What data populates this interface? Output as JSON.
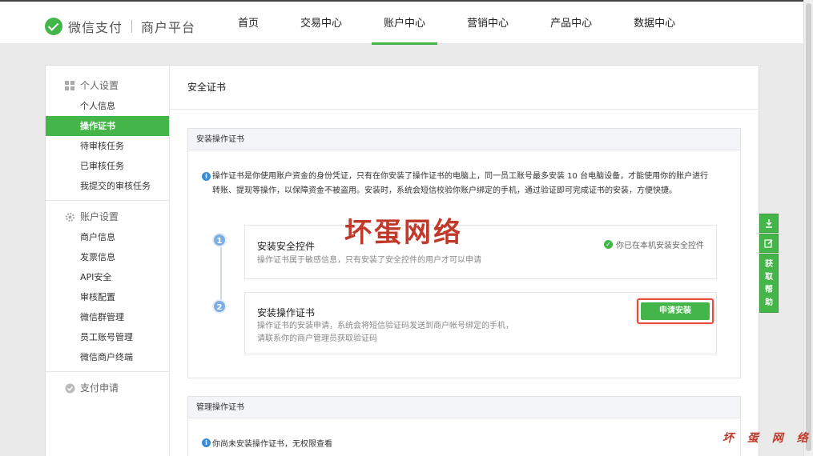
{
  "header": {
    "brand": "微信支付",
    "brand_sub": "商户平台",
    "nav": [
      "首页",
      "交易中心",
      "账户中心",
      "营销中心",
      "产品中心",
      "数据中心"
    ],
    "active_nav": 2
  },
  "sidebar": {
    "groups": [
      {
        "label": "个人设置",
        "icon": "grid-icon",
        "items": [
          "个人信息",
          "操作证书",
          "待审核任务",
          "已审核任务",
          "我提交的审核任务"
        ]
      },
      {
        "label": "账户设置",
        "icon": "gear-icon",
        "items": [
          "商户信息",
          "发票信息",
          "API安全",
          "审核配置",
          "微信群管理",
          "员工账号管理",
          "微信商户终端"
        ]
      },
      {
        "label": "支付申请",
        "icon": "payment-icon",
        "items": []
      }
    ],
    "active_item": "操作证书"
  },
  "content": {
    "title": "安全证书",
    "install_section": {
      "heading": "安装操作证书",
      "info": "操作证书是你使用账户资金的身份凭证，只有在你安装了操作证书的电脑上，同一员工账号最多安装 10 台电脑设备，才能使用你的账户进行转账、提现等操作，以保障资金不被盗用。安装时，系统会短信校验你账户绑定的手机，通过验证即可完成证书的安装，方便快捷。",
      "steps": [
        {
          "num": "1",
          "title": "安装安全控件",
          "desc": "操作证书属于敏感信息，只有安装了安全控件的用户才可以申请",
          "status": "你已在本机安装安全控件"
        },
        {
          "num": "2",
          "title": "安装操作证书",
          "desc1": "操作证书的安装申请，系统会将短信验证码发送到商户帐号绑定的手机，",
          "desc2": "请联系你的商户管理员获取验证码",
          "button": "申请安装"
        }
      ]
    },
    "manage_section": {
      "heading": "管理操作证书",
      "info": "你尚未安装操作证书，无权限查看"
    }
  },
  "watermark": {
    "main": "坏蛋网络",
    "corner": "坏 蛋 网 络"
  },
  "float_bar": {
    "help": [
      "获",
      "取",
      "帮",
      "助"
    ]
  },
  "colors": {
    "accent": "#44b549",
    "info": "#3c8cd6",
    "highlight": "#e74c3c"
  }
}
